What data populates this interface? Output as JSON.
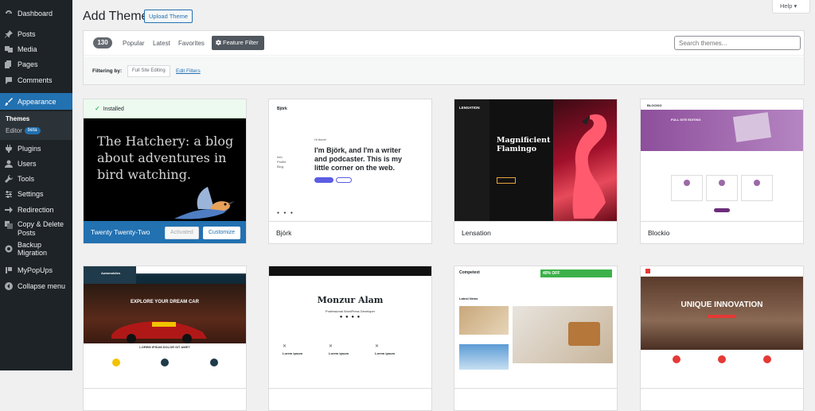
{
  "sidebar": {
    "items": [
      {
        "label": "Dashboard",
        "icon": "dashboard-icon"
      },
      {
        "label": "Posts",
        "icon": "pin-icon"
      },
      {
        "label": "Media",
        "icon": "media-icon"
      },
      {
        "label": "Pages",
        "icon": "page-icon"
      },
      {
        "label": "Comments",
        "icon": "comment-icon"
      },
      {
        "label": "Appearance",
        "icon": "brush-icon"
      },
      {
        "label": "Plugins",
        "icon": "plugin-icon"
      },
      {
        "label": "Users",
        "icon": "user-icon"
      },
      {
        "label": "Tools",
        "icon": "wrench-icon"
      },
      {
        "label": "Settings",
        "icon": "settings-icon"
      },
      {
        "label": "Redirection",
        "icon": "redirection-icon"
      },
      {
        "label": "Copy & Delete Posts",
        "icon": "copy-icon"
      },
      {
        "label": "Backup Migration",
        "icon": "backup-icon"
      },
      {
        "label": "MyPopUps",
        "icon": "popup-icon"
      },
      {
        "label": "Collapse menu",
        "icon": "collapse-icon"
      }
    ],
    "submenu": {
      "themes": "Themes",
      "editor": "Editor",
      "beta": "beta"
    }
  },
  "header": {
    "title": "Add Themes",
    "upload": "Upload Theme",
    "help": "Help ▾"
  },
  "filters": {
    "count": "130",
    "popular": "Popular",
    "latest": "Latest",
    "favorites": "Favorites",
    "feature_filter": "Feature Filter",
    "search_placeholder": "Search themes...",
    "filtering_by": "Filtering by:",
    "tag": "Full Site Editing",
    "edit": "Edit Filters"
  },
  "themes": [
    {
      "name": "Twenty Twenty-Two",
      "installed": "Installed",
      "activated": "Activated",
      "customize": "Customize",
      "headline": "The Hatchery: a blog about adventures in bird watching."
    },
    {
      "name": "Björk",
      "brand": "Björk",
      "hi": "Hi there!",
      "headline": "I'm Björk, and I'm a writer and podcaster. This is my little corner on the web.",
      "nav": [
        "Info",
        "Profile",
        "Blog"
      ]
    },
    {
      "name": "Lensation",
      "brand": "LENSATION",
      "headline": "Magnificient Flamingo"
    },
    {
      "name": "Blockio",
      "brand": "BLOCKIO",
      "hero": "FULL SITE EDITING"
    },
    {
      "name": "",
      "brand": "Automobiles",
      "headline": "EXPLORE YOUR DREAM CAR",
      "sub": "LOREM IPSUM DOLOR SIT AMET"
    },
    {
      "name": "",
      "headline": "Monzur Alam",
      "sub": "Professional WordPress Developer",
      "items": [
        "Lorem ipsum",
        "Lorem ipsum",
        "Lorem ipsum"
      ]
    },
    {
      "name": "",
      "brand": "Competext",
      "badge": "40% OFF",
      "section": "Latest News"
    },
    {
      "name": "",
      "headline": "UNIQUE INNOVATION"
    }
  ],
  "colors": {
    "accent": "#2271b1",
    "sidebar": "#1d2327",
    "installed": "#00a32a"
  }
}
